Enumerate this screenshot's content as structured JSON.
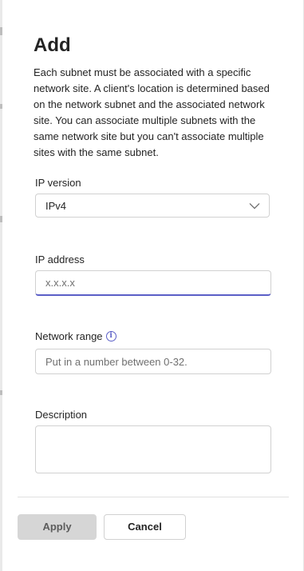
{
  "panel": {
    "title": "Add",
    "description": "Each subnet must be associated with a specific network site. A client's location is determined based on the network subnet and the associated network site. You can associate multiple subnets with the same network site but you can't associate multiple sites with the same subnet."
  },
  "fields": {
    "ip_version": {
      "label": "IP version",
      "value": "IPv4",
      "icon": "chevron-down-icon"
    },
    "ip_address": {
      "label": "IP address",
      "placeholder": "x.x.x.x",
      "value": ""
    },
    "network_range": {
      "label": "Network range",
      "info_icon": "i",
      "placeholder": "Put in a number between 0-32.",
      "value": ""
    },
    "description": {
      "label": "Description",
      "value": ""
    }
  },
  "footer": {
    "apply_label": "Apply",
    "cancel_label": "Cancel"
  },
  "colors": {
    "accent": "#5b5fc7",
    "disabled_button": "#d6d6d6",
    "border": "#d1d1d1"
  }
}
